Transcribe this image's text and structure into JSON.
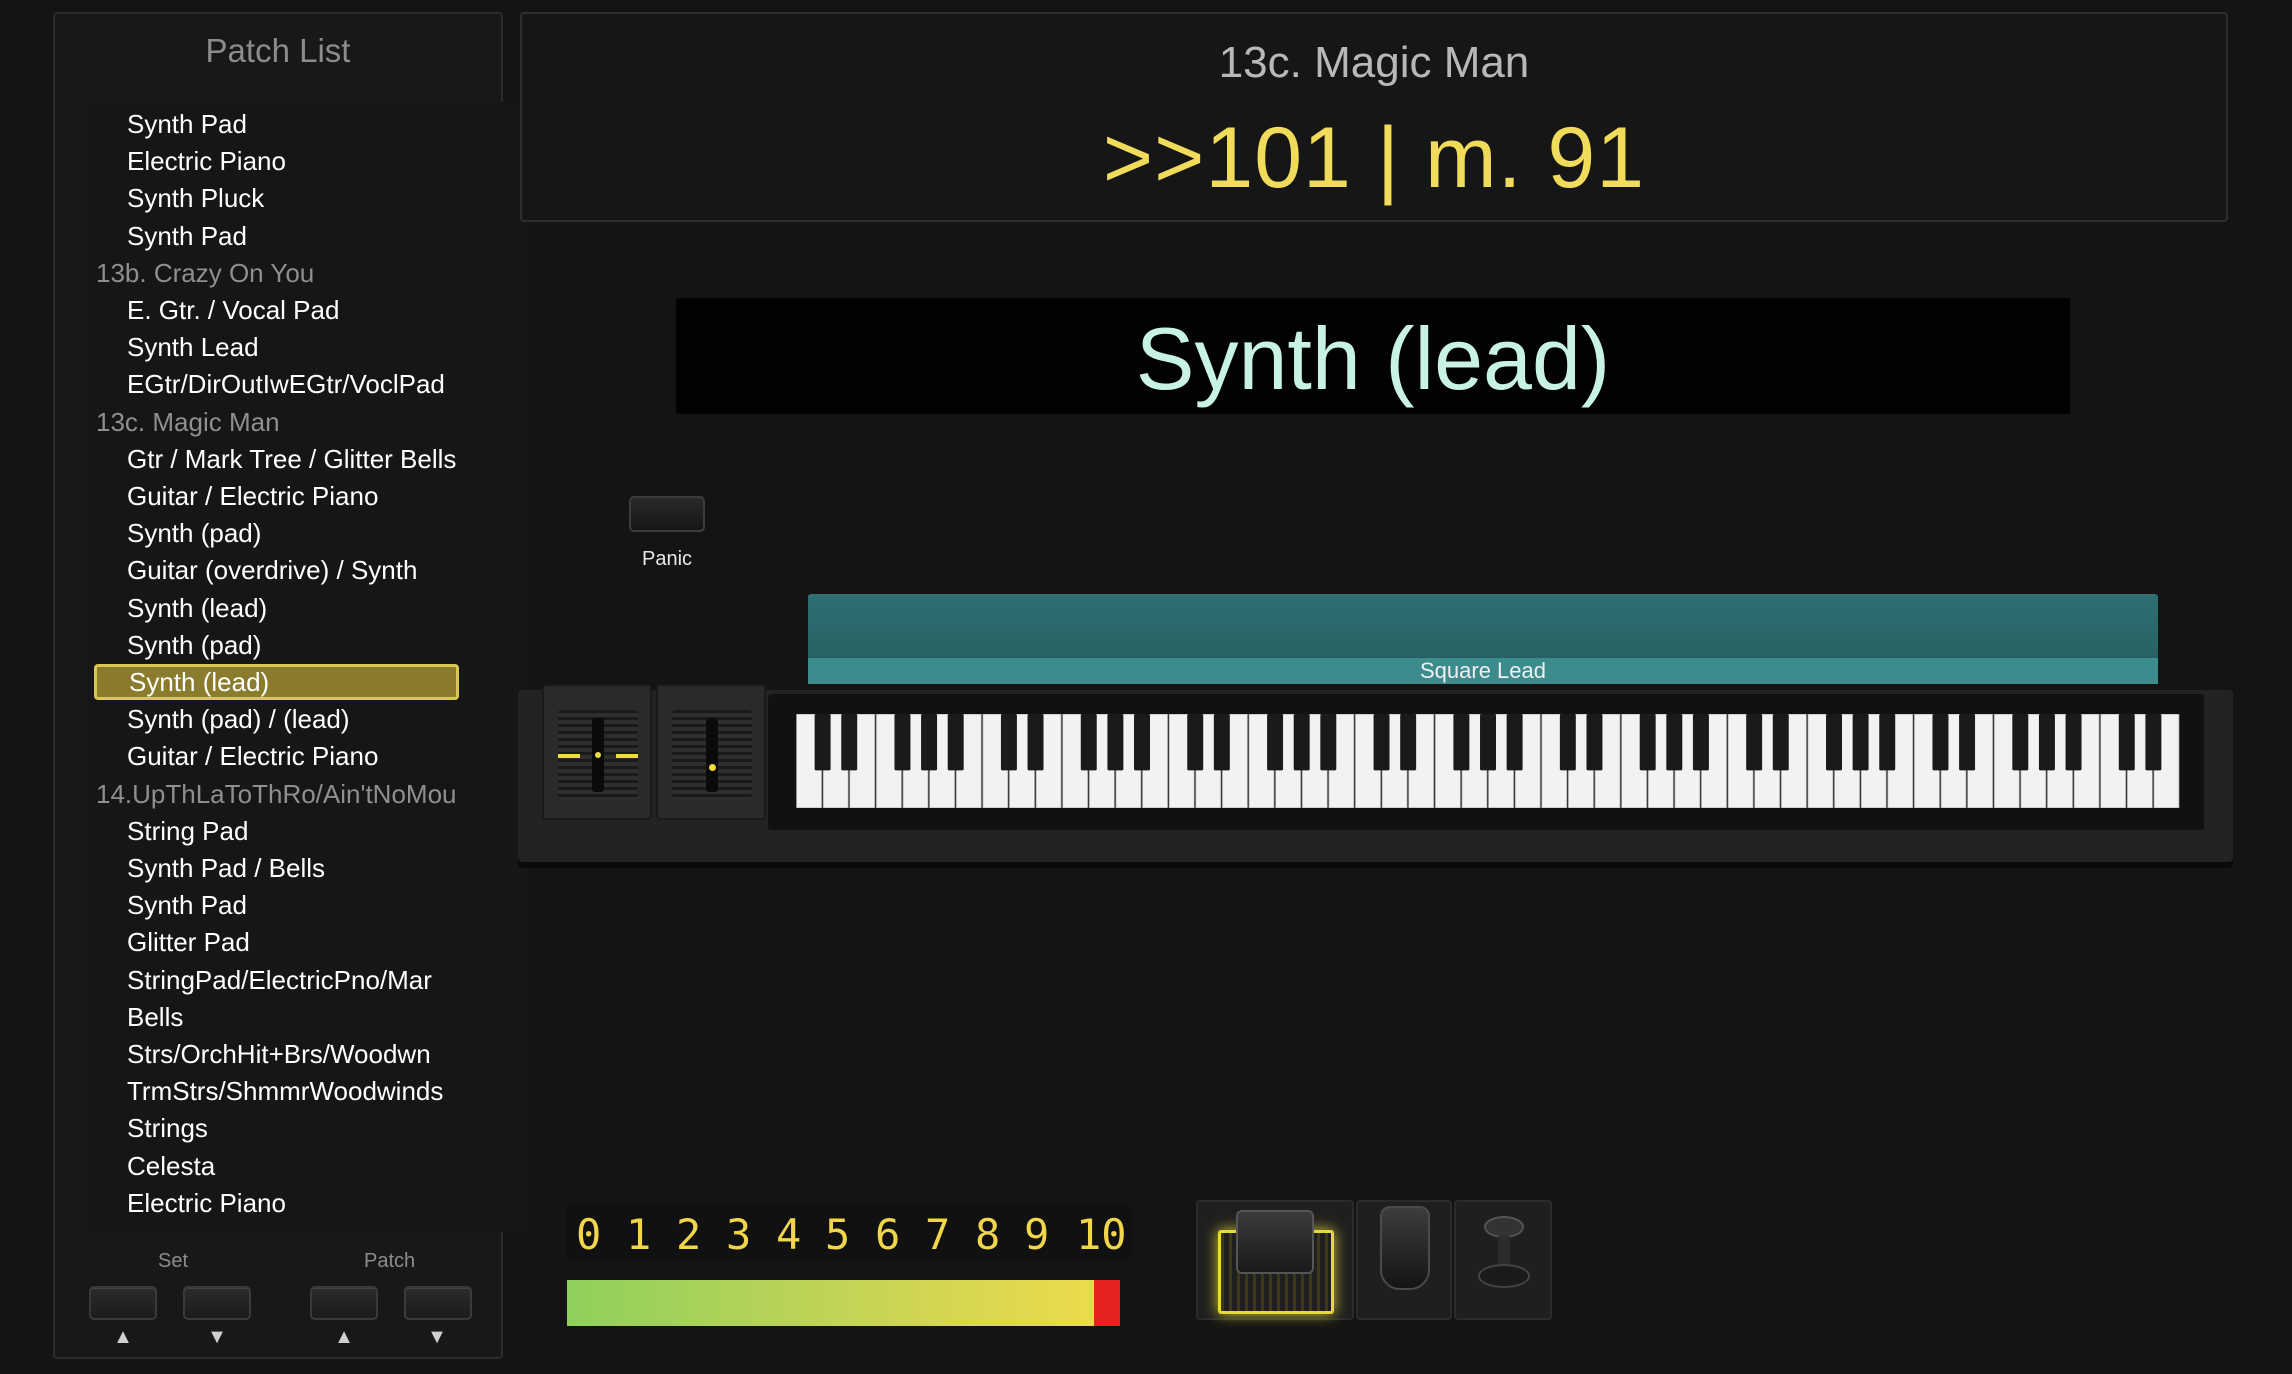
{
  "sidebar": {
    "title": "Patch List",
    "items": [
      {
        "label": "Synth Pad",
        "kind": "patch"
      },
      {
        "label": "Electric Piano",
        "kind": "patch"
      },
      {
        "label": "Synth Pluck",
        "kind": "patch"
      },
      {
        "label": "Synth Pad",
        "kind": "patch"
      },
      {
        "label": "13b. Crazy On You",
        "kind": "set"
      },
      {
        "label": "E. Gtr. / Vocal Pad",
        "kind": "patch"
      },
      {
        "label": "Synth Lead",
        "kind": "patch"
      },
      {
        "label": "EGtr/DirOutIwEGtr/VoclPad",
        "kind": "patch"
      },
      {
        "label": "13c. Magic Man",
        "kind": "set"
      },
      {
        "label": "Gtr / Mark Tree / Glitter Bells",
        "kind": "patch"
      },
      {
        "label": "Guitar / Electric Piano",
        "kind": "patch"
      },
      {
        "label": "Synth (pad)",
        "kind": "patch"
      },
      {
        "label": "Guitar (overdrive) / Synth",
        "kind": "patch"
      },
      {
        "label": "Synth (lead)",
        "kind": "patch"
      },
      {
        "label": "Synth (pad)",
        "kind": "patch"
      },
      {
        "label": "Synth (lead)",
        "kind": "patch",
        "selected": true
      },
      {
        "label": "Synth (pad) / (lead)",
        "kind": "patch"
      },
      {
        "label": "Guitar / Electric Piano",
        "kind": "patch"
      },
      {
        "label": "14.UpThLaToThRo/Ain'tNoMou",
        "kind": "set"
      },
      {
        "label": "String Pad",
        "kind": "patch"
      },
      {
        "label": "Synth Pad / Bells",
        "kind": "patch"
      },
      {
        "label": "Synth Pad",
        "kind": "patch"
      },
      {
        "label": "Glitter Pad",
        "kind": "patch"
      },
      {
        "label": "StringPad/ElectricPno/Mar",
        "kind": "patch"
      },
      {
        "label": "Bells",
        "kind": "patch"
      },
      {
        "label": "Strs/OrchHit+Brs/Woodwn",
        "kind": "patch"
      },
      {
        "label": "TrmStrs/ShmmrWoodwinds",
        "kind": "patch"
      },
      {
        "label": "Strings",
        "kind": "patch"
      },
      {
        "label": "Celesta",
        "kind": "patch"
      },
      {
        "label": "Electric Piano",
        "kind": "patch"
      }
    ],
    "nav": {
      "set_label": "Set",
      "patch_label": "Patch",
      "up_arrow": "▲",
      "down_arrow": "▼"
    }
  },
  "header": {
    "song_title": "13c. Magic Man",
    "position": ">>101 | m. 91"
  },
  "patch_banner": {
    "name": "Synth (lead)"
  },
  "panic": {
    "label": "Panic"
  },
  "keyboard": {
    "layer_label": "Square Lead",
    "white_keys": 52,
    "layer_color": "#2f6f72"
  },
  "meter": {
    "numbers": [
      "0",
      "1",
      "2",
      "3",
      "4",
      "5",
      "6",
      "7",
      "8",
      "9",
      "10"
    ],
    "number_color": "#f2d64a"
  },
  "colors": {
    "accent_yellow": "#f0dc5a",
    "banner_text": "#c8f2e2",
    "selected_bg": "#8a7c2c",
    "selected_border": "#d9c750"
  }
}
